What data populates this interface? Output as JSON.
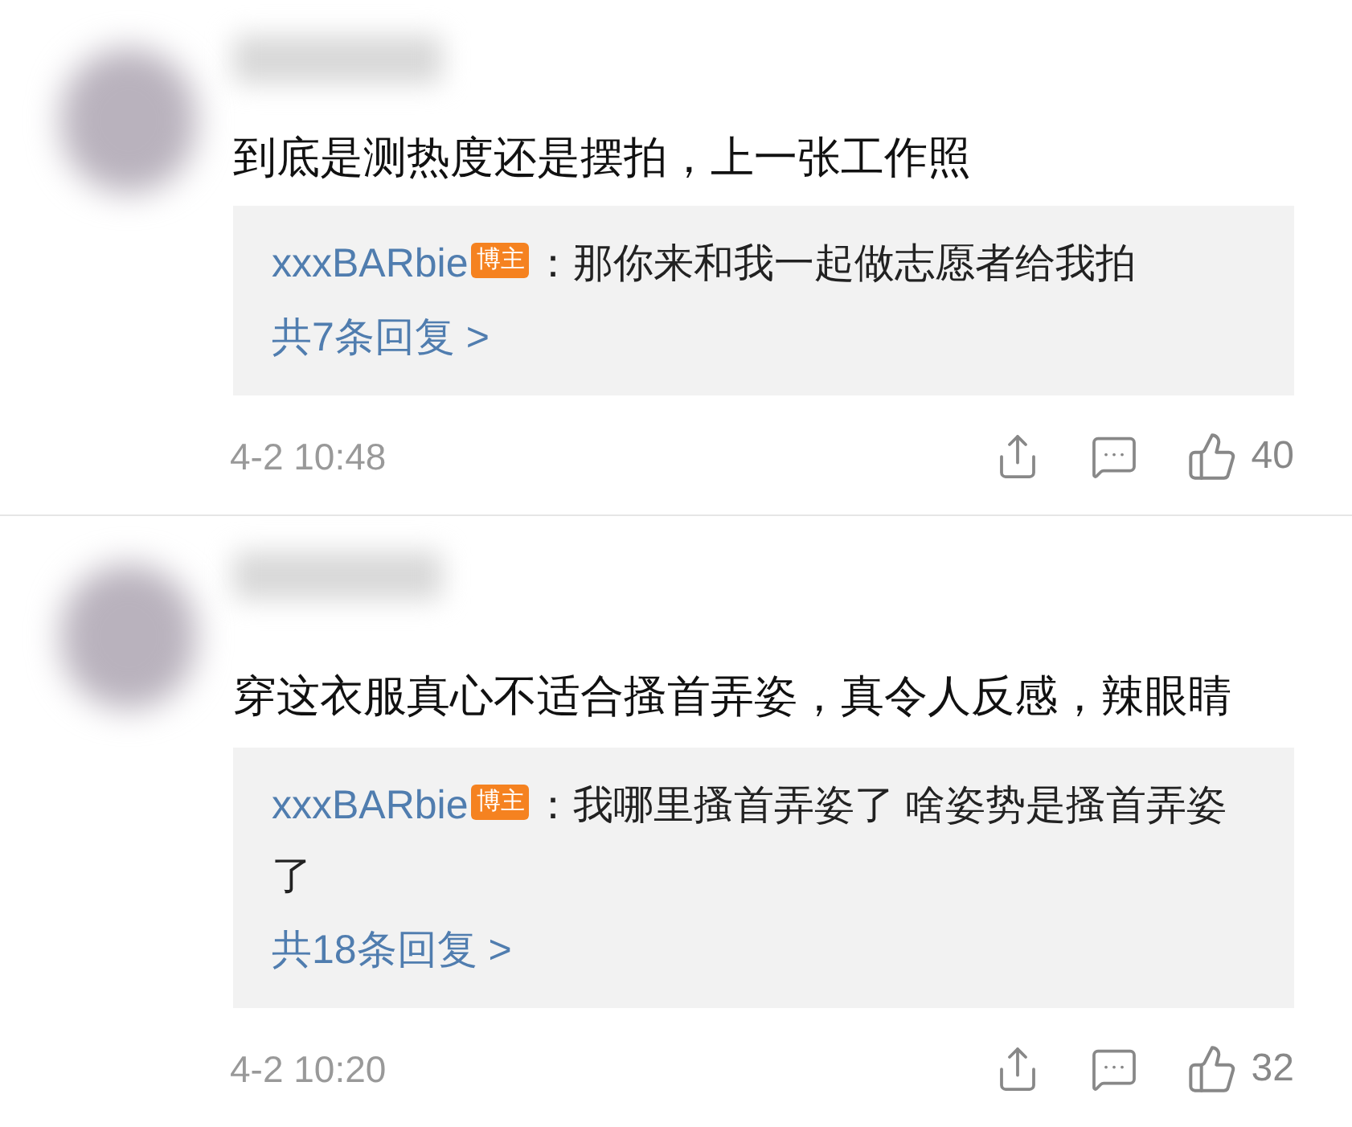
{
  "comments": [
    {
      "text": "到底是测热度还是摆拍，上一张工作照",
      "reply": {
        "user": "xxxBARbie",
        "badge": "博主",
        "text": "：那你来和我一起做志愿者给我拍"
      },
      "more_replies": "共7条回复 >",
      "time": "4-2 10:48",
      "likes": "40"
    },
    {
      "text": "穿这衣服真心不适合搔首弄姿，真令人反感，辣眼睛",
      "reply": {
        "user": "xxxBARbie",
        "badge": "博主",
        "text": "：我哪里搔首弄姿了 啥姿势是搔首弄姿了"
      },
      "more_replies": "共18条回复 >",
      "time": "4-2 10:20",
      "likes": "32"
    }
  ]
}
